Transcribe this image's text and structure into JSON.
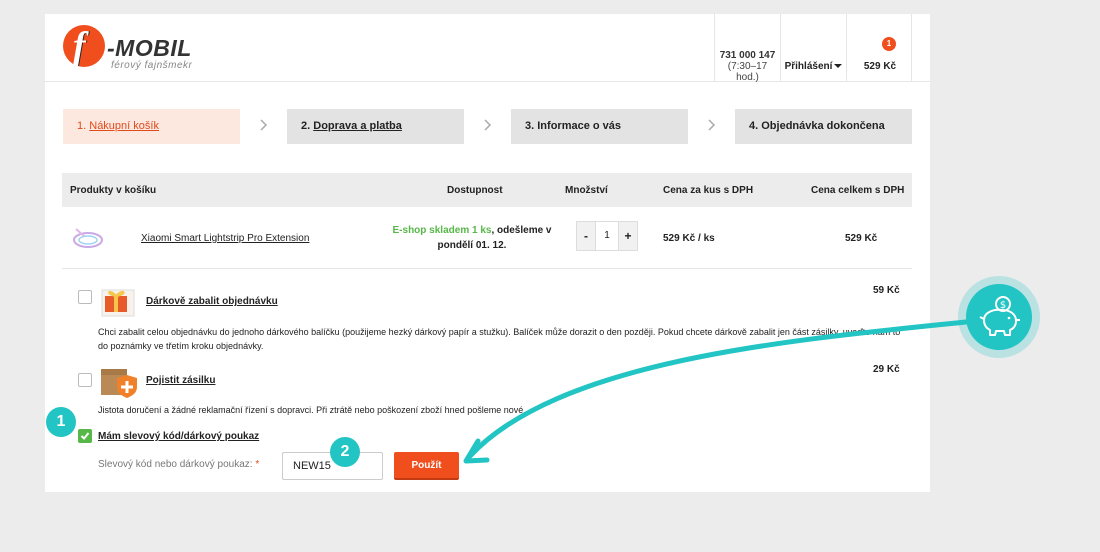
{
  "header": {
    "logo_text": "f-MOBIL",
    "logo_tagline": "férový fajnšmekr",
    "phone": "731 000 147",
    "hours": "(7:30–17 hod.)",
    "login_label": "Přihlášení",
    "cart_count": "1",
    "cart_total": "529 Kč"
  },
  "steps": [
    {
      "num": "1.",
      "label": "Nákupní košík"
    },
    {
      "num": "2.",
      "label": "Doprava a platba"
    },
    {
      "num": "3.",
      "label": "Informace o vás"
    },
    {
      "num": "4.",
      "label": "Objednávka dokončena"
    }
  ],
  "table": {
    "headers": [
      "Produkty v košíku",
      "Dostupnost",
      "Množství",
      "Cena za kus s DPH",
      "Cena celkem s DPH"
    ],
    "product": {
      "name": "Xiaomi Smart Lightstrip Pro Extension",
      "availability_green": "E-shop skladem 1 ks",
      "availability_rest": ", odešleme v pondělí 01. 12.",
      "qty": "1",
      "qty_minus": "-",
      "qty_plus": "+",
      "unit_price": "529 Kč / ks",
      "total_price": "529 Kč"
    }
  },
  "options": {
    "gift": {
      "title": "Dárkově zabalit objednávku",
      "desc": "Chci zabalit celou objednávku do jednoho dárkového balíčku (použijeme hezký dárkový papír a stužku). Balíček může dorazit o den později. Pokud chcete dárkově zabalit jen část zásilky, uveďte nám to do poznámky ve třetím kroku objednávky.",
      "price": "59 Kč"
    },
    "insurance": {
      "title": "Pojistit zásilku",
      "desc": "Jistota doručení a žádné reklamační řízení s dopravci. Při ztrátě nebo poškození zboží hned pošleme nové.",
      "price": "29 Kč"
    },
    "voucher": {
      "title": "Mám slevový kód/dárkový poukaz",
      "label": "Slevový kód nebo dárkový poukaz:",
      "required_mark": "*",
      "code_value": "NEW15",
      "apply_label": "Použít"
    }
  },
  "annotations": {
    "badge_1": "1",
    "badge_2": "2"
  },
  "colors": {
    "accent": "#f04e1d",
    "teal": "#22c4c4",
    "green": "#56b847"
  }
}
